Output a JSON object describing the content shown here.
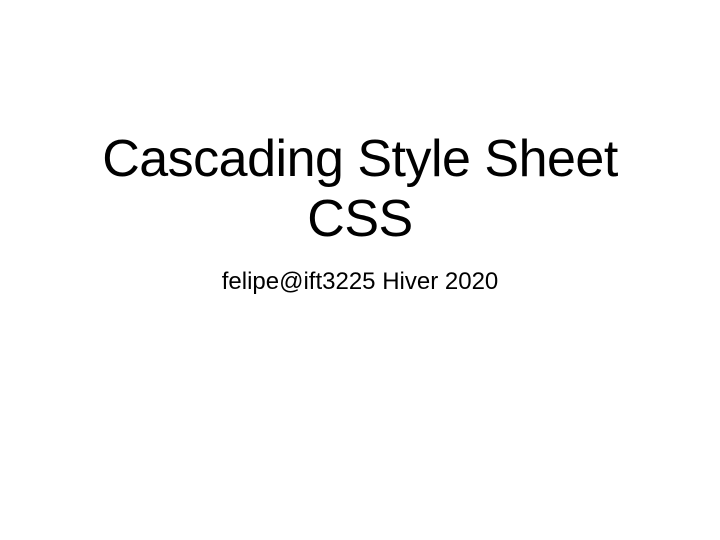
{
  "slide": {
    "title_line1": "Cascading Style Sheet",
    "title_line2": "CSS",
    "subtitle": "felipe@ift3225 Hiver 2020"
  }
}
